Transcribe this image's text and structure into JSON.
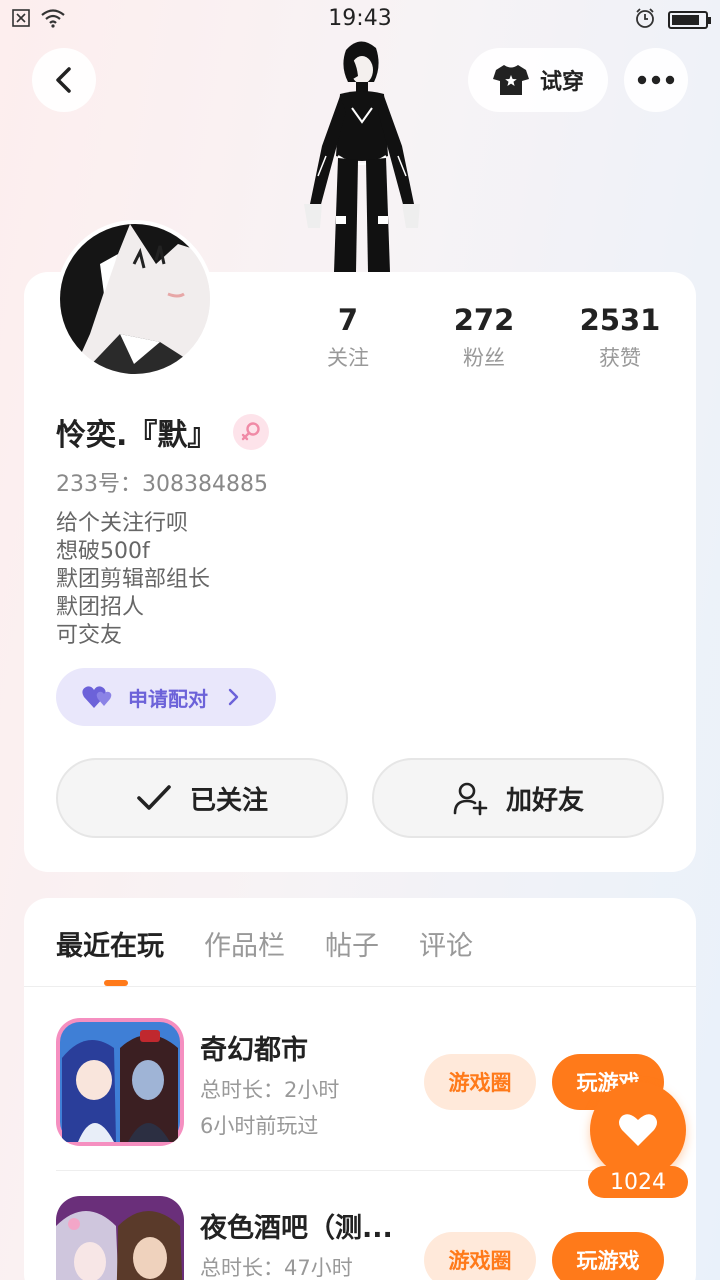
{
  "status_bar": {
    "time": "19:43",
    "battery_level": 0.85
  },
  "top_bar": {
    "try_on_label": "试穿"
  },
  "profile": {
    "stats": [
      {
        "value": "7",
        "label": "关注"
      },
      {
        "value": "272",
        "label": "粉丝"
      },
      {
        "value": "2531",
        "label": "获赞"
      }
    ],
    "nickname": "怜奕.『默』",
    "gender_icon": "female-icon",
    "uid": "233号：308384885",
    "bio": [
      "给个关注行呗",
      "想破500f",
      "默团剪辑部组长",
      "默团招人",
      "可交友"
    ],
    "pair_label": "申请配对",
    "follow_label": "已关注",
    "add_friend_label": "加好友"
  },
  "tabs": [
    "最近在玩",
    "作品栏",
    "帖子",
    "评论"
  ],
  "games": [
    {
      "title": "奇幻都市",
      "duration": "总时长：2小时",
      "last_played": "6小时前玩过",
      "circle_label": "游戏圈",
      "play_label": "玩游戏"
    },
    {
      "title": "夜色酒吧（测...",
      "duration": "总时长：47小时",
      "circle_label": "游戏圈",
      "play_label": "玩游戏"
    }
  ],
  "like": {
    "count": "1024"
  },
  "colors": {
    "accent": "#ff7a1a",
    "pair": "#6c62d9",
    "gender": "#f08aa6"
  }
}
